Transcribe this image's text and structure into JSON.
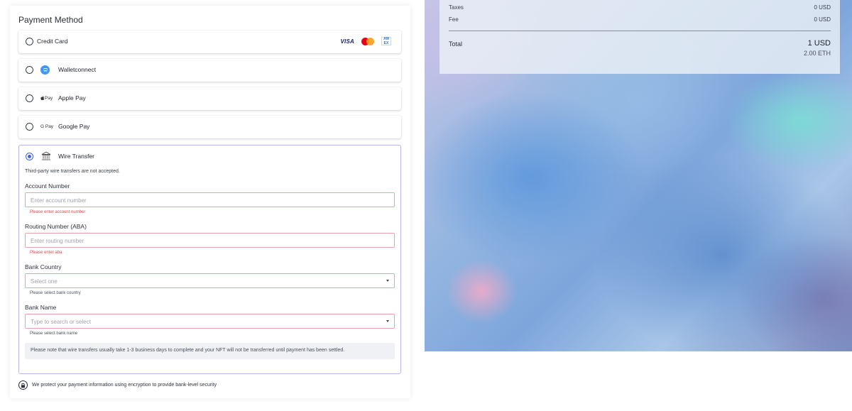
{
  "summary": {
    "taxes_label": "Taxes",
    "taxes_value": "0 USD",
    "fee_label": "Fee",
    "fee_value": "0 USD",
    "total_label": "Total",
    "total_usd": "1 USD",
    "total_eth": "2.00 ETH"
  },
  "payment": {
    "title": "Payment Method",
    "options": [
      {
        "label": "Credit Card",
        "selected": false,
        "logos": {
          "visa": "VISA",
          "mastercard": "mastercard-icon",
          "amex": "AM EX"
        }
      },
      {
        "label": "Walletconnect",
        "selected": false,
        "icon": "walletconnect-icon"
      },
      {
        "label": "Apple Pay",
        "selected": false,
        "icon_text": "Pay"
      },
      {
        "label": "Google Pay",
        "selected": false,
        "icon_text": "G Pay"
      },
      {
        "label": "Wire Transfer",
        "selected": true,
        "icon": "bank-icon"
      }
    ],
    "wire": {
      "note": "Third-party wire transfers are not accepted.",
      "account_number": {
        "label": "Account Number",
        "placeholder": "Enter account number",
        "error": "Please enter account number"
      },
      "routing_number": {
        "label": "Routing Number (ABA)",
        "placeholder": "Enter routing number",
        "error": "Please enter aba"
      },
      "bank_country": {
        "label": "Bank Country",
        "placeholder": "Select one",
        "hint": "Please select bank country"
      },
      "bank_name": {
        "label": "Bank Name",
        "placeholder": "Type to search or select",
        "hint": "Please select bank name"
      },
      "notice": "Please note that wire transfers usually take 1-3 business days to complete and your NFT will not be transferred until payment has been settled."
    },
    "security_text": "We protect your payment information using encryption to provide bank-level security"
  },
  "colors": {
    "accent": "#3d63d4",
    "error": "#e0464e",
    "selected_border": "#b9b6e6"
  }
}
